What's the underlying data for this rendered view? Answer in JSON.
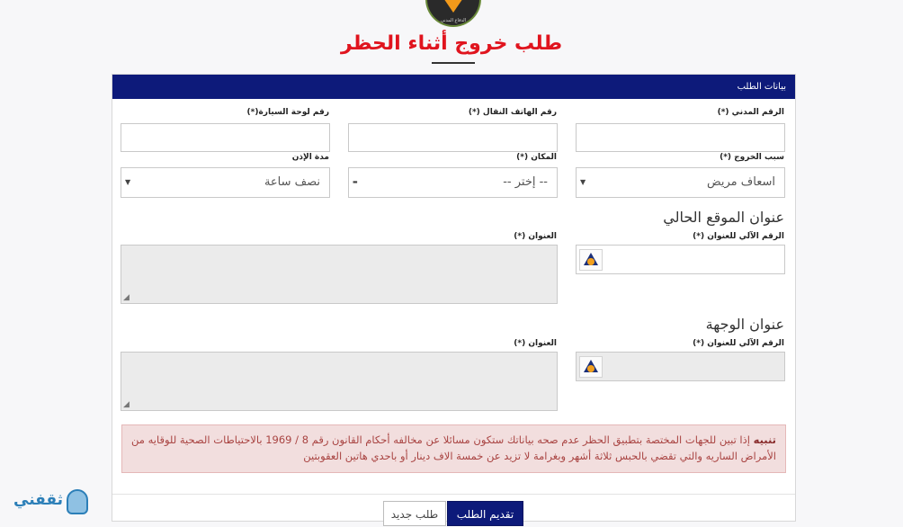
{
  "logo": {
    "caption": "الدفاع المدني"
  },
  "page": {
    "title": "طلب خروج أثناء الحظر"
  },
  "card": {
    "header": "بيانات الطلب"
  },
  "fields": {
    "civil_id": {
      "label": "الرقم المدني (*)",
      "value": ""
    },
    "mobile": {
      "label": "رقم الهاتف النقال (*)",
      "value": ""
    },
    "plate": {
      "label": "رقم لوحة السيارة(*)",
      "value": ""
    },
    "reason": {
      "label": "سبب الخروج (*)",
      "value": "اسعاف مريض"
    },
    "place": {
      "label": "المكان (*)",
      "value": "-- إختر --"
    },
    "duration": {
      "label": "مدة الإذن",
      "value": "نصف ساعة"
    }
  },
  "current_location": {
    "heading": "عنوان الموقع الحالي",
    "auto_number_label": "الرقم الآلي للعنوان (*)",
    "address_label": "العنوان (*)"
  },
  "destination": {
    "heading": "عنوان الوجهة",
    "auto_number_label": "الرقم الآلي للعنوان (*)",
    "address_label": "العنوان (*)"
  },
  "alert": {
    "bold": "تنبيه",
    "text": " إذا تبين للجهات المختصة بتطبيق الحظر عدم صحه بياناتك ستكون مسائلا عن مخالفه أحكام القانون رقم 8 / 1969 بالاحتياطات الصحية للوقايه من الأمراض الساريه والتي تقضي بالحبس ثلاثة أشهر وبغرامة لا تزيد عن خمسة الاف دينار أو باحدي هاتين العقوبتين"
  },
  "buttons": {
    "submit": "تقديم الطلب",
    "new_request": "طلب جديد"
  },
  "watermark": {
    "text": "ثقفني"
  },
  "colors": {
    "brand": "#0d1a7a",
    "title_red": "#e0141e",
    "alert_bg": "#f2dede"
  },
  "icons": {
    "address": "paci-address-icon",
    "select": "caret-down-icon",
    "resize": "resize-grip-icon"
  }
}
